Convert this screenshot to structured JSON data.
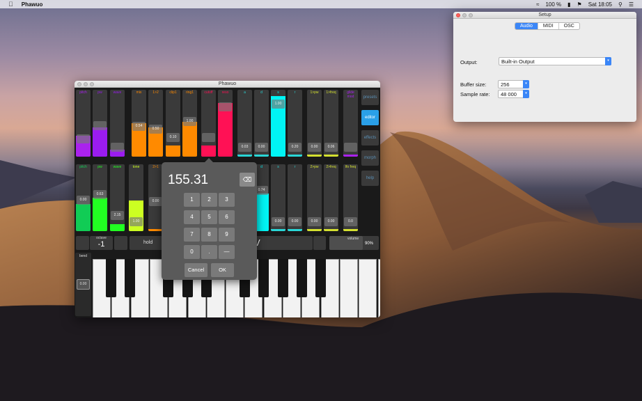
{
  "menubar": {
    "app": "Phawuo",
    "battery": "100 %",
    "clock": "Sat 18:05"
  },
  "setup": {
    "title": "Setup",
    "tabs": [
      "Audio",
      "MIDI",
      "OSC"
    ],
    "output_label": "Output:",
    "output_value": "Built-in Output",
    "buffer_label": "Buffer size:",
    "buffer_value": "256",
    "rate_label": "Sample rate:",
    "rate_value": "48 000"
  },
  "phawuo": {
    "title": "Phawuo",
    "row1": [
      {
        "label": "pitch",
        "value": "",
        "color": "#aa22ee",
        "fill": 0.35,
        "thumb": 0.25
      },
      {
        "label": "pw",
        "value": "",
        "color": "#9b1cf0",
        "fill": 0.48,
        "thumb": 0.52
      },
      {
        "label": "wave",
        "value": "",
        "color": "#9b1cf0",
        "fill": 0.12,
        "thumb": 0.1
      },
      {
        "label": "mix",
        "value": "0.54",
        "color": "#ff8a00",
        "fill": 0.55,
        "thumb": 0.5
      },
      {
        "label": "1>2",
        "value": "0.50",
        "color": "#ff8a00",
        "fill": 0.48,
        "thumb": 0.44
      },
      {
        "label": "clip1",
        "value": "0.10",
        "color": "#ff8a00",
        "fill": 0.18,
        "thumb": 0.28
      },
      {
        "label": "ring1",
        "value": "1.00",
        "color": "#ff8a00",
        "fill": 0.58,
        "thumb": 0.6
      },
      {
        "label": "cutoff",
        "value": "",
        "color": "#ff1155",
        "fill": 0.18,
        "thumb": 0.28
      },
      {
        "label": "reso",
        "value": "",
        "color": "#ff1155",
        "fill": 0.88,
        "thumb": 0.88
      },
      {
        "label": "a",
        "value": "0.03",
        "color": "#2ad6d6",
        "fill": 0.04,
        "thumb": 0.1
      },
      {
        "label": "d",
        "value": "0.00",
        "color": "#2ad6d6",
        "fill": 0.04,
        "thumb": 0.1
      },
      {
        "label": "s",
        "value": "1.00",
        "color": "#00f4f4",
        "fill": 1.0,
        "thumb": 0.93
      },
      {
        "label": "r",
        "value": "0.20",
        "color": "#2ad6d6",
        "fill": 0.04,
        "thumb": 0.1
      },
      {
        "label": "1>pw",
        "value": "0.00",
        "color": "#d4e030",
        "fill": 0.04,
        "thumb": 0.1
      },
      {
        "label": "1>freq",
        "value": "0.06",
        "color": "#d4e030",
        "fill": 0.04,
        "thumb": 0.1
      },
      {
        "label": "glide mod",
        "value": "",
        "color": "#aa22ee",
        "fill": 0.04,
        "thumb": 0.1
      }
    ],
    "row2": [
      {
        "label": "pitch",
        "value": "0.00",
        "color": "#11cc55",
        "fill": 0.45,
        "thumb": 0.52
      },
      {
        "label": "pw",
        "value": "0.63",
        "color": "#22ff22",
        "fill": 0.55,
        "thumb": 0.62
      },
      {
        "label": "wave",
        "value": "2.15",
        "color": "#22ff22",
        "fill": 0.12,
        "thumb": 0.22
      },
      {
        "label": "tone",
        "value": "1.00",
        "color": "#ccff22",
        "fill": 0.5,
        "thumb": 0.1
      },
      {
        "label": "2>1",
        "value": "0.00",
        "color": "#ff8a00",
        "fill": 0.04,
        "thumb": 0.48
      },
      {
        "label": "d",
        "value": "0.74",
        "color": "#00f4f4",
        "fill": 0.62,
        "thumb": 0.7
      },
      {
        "label": "s",
        "value": "0.00",
        "color": "#2ad6d6",
        "fill": 0.04,
        "thumb": 0.1
      },
      {
        "label": "r",
        "value": "0.00",
        "color": "#2ad6d6",
        "fill": 0.04,
        "thumb": 0.1
      },
      {
        "label": "2>pw",
        "value": "0.00",
        "color": "#d4e030",
        "fill": 0.04,
        "thumb": 0.1
      },
      {
        "label": "2>freq",
        "value": "0.00",
        "color": "#d4e030",
        "fill": 0.04,
        "thumb": 0.1
      },
      {
        "label": "lfo freq",
        "value": "0.0",
        "color": "#d4e030",
        "fill": 0.04,
        "thumb": 0.1
      }
    ],
    "side": [
      "presets",
      "editor",
      "effects",
      "morph",
      "help"
    ],
    "octave_label": "octave",
    "octave_value": "-1",
    "hold": "hold",
    "volume_label": "volume",
    "volume_value": "90%",
    "bend_label": "bend",
    "bend_value": "0.00",
    "partial_glyph": "V"
  },
  "keypad": {
    "display": "155.31",
    "keys": [
      "1",
      "2",
      "3",
      "4",
      "5",
      "6",
      "7",
      "8",
      "9",
      "0",
      ".",
      "—"
    ],
    "backspace": "⌫",
    "cancel": "Cancel",
    "ok": "OK"
  }
}
